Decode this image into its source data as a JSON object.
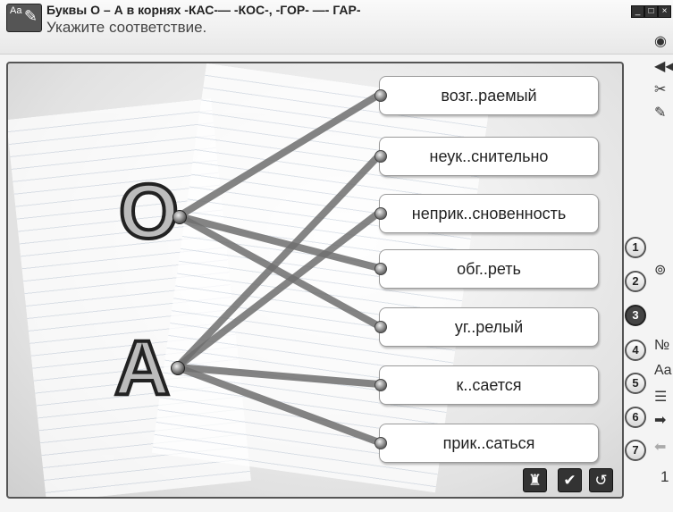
{
  "header": {
    "icon_text": "Aa",
    "title": "Буквы О – А в корнях  -КАС-— -КОС-, -ГОР- —- ГАР-",
    "subtitle": "Укажите соответствие."
  },
  "window_controls": [
    "_",
    "□",
    "×"
  ],
  "letters": {
    "o": "О",
    "a": "А"
  },
  "items": [
    "возг..раемый",
    "неук..снительно",
    "неприк..сновенность",
    "обг..реть",
    "уг..релый",
    "к..сается",
    "прик..саться"
  ],
  "connections": [
    {
      "from": "o",
      "to": 0
    },
    {
      "from": "o",
      "to": 3
    },
    {
      "from": "o",
      "to": 4
    },
    {
      "from": "a",
      "to": 1
    },
    {
      "from": "a",
      "to": 2
    },
    {
      "from": "a",
      "to": 5
    },
    {
      "from": "a",
      "to": 6
    }
  ],
  "bottom_buttons": {
    "hint": "hint-icon",
    "check": "✔",
    "reset": "↺"
  },
  "nav_numbers": [
    "1",
    "2",
    "3",
    "4",
    "5",
    "6",
    "7"
  ],
  "active_number": "3",
  "side_icons": [
    "sound-icon",
    "rewind-icon",
    "tools-icon",
    "pencil-icon",
    "help-icon",
    "number-icon",
    "font-icon",
    "list-icon",
    "next-arrow-icon",
    "prev-arrow-icon"
  ],
  "page_number": "1",
  "colors": {
    "line": "#6f6f6f",
    "panel_border": "#555555"
  }
}
